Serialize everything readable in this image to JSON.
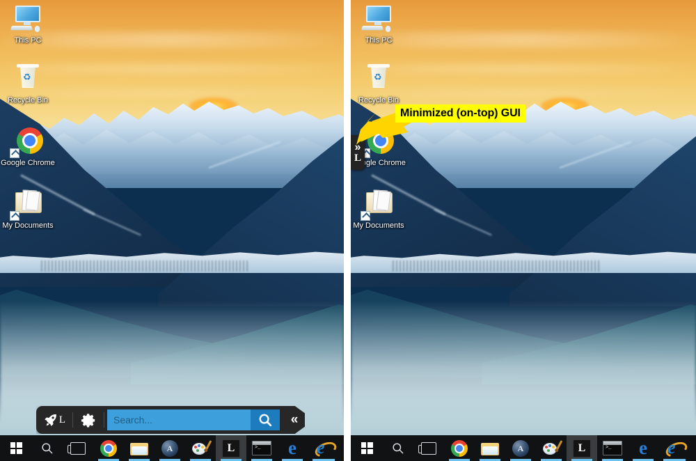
{
  "annotation": {
    "label": "Minimized (on-top) GUI",
    "label_bg": "#ffff00",
    "label_fg": "#000000",
    "arrow_color": "#ffd400"
  },
  "desktop": {
    "icons": [
      {
        "label": "This PC",
        "icon": "this-pc-icon"
      },
      {
        "label": "Recycle Bin",
        "icon": "recycle-bin-icon"
      },
      {
        "label": "Google Chrome",
        "icon": "google-chrome-icon"
      },
      {
        "label": "My Documents",
        "icon": "my-documents-icon"
      }
    ]
  },
  "gui_bar": {
    "rocket_icon": "rocket-icon",
    "rocket_letter": "L",
    "gear_icon": "gear-icon",
    "search": {
      "value": "",
      "placeholder": "Search...",
      "field_color": "#3da0dc",
      "button_color": "#1c7cbd",
      "button_icon": "magnifier-icon"
    },
    "collapse_label": "«",
    "bar_color": "#272727"
  },
  "minimized_gui": {
    "expand_label": "»",
    "app_letter": "L",
    "tab_color": "#232323"
  },
  "taskbar": {
    "background": "#101214",
    "items": [
      {
        "name": "start-button",
        "icon": "windows-logo-icon",
        "label": "Start",
        "running": false,
        "active": false
      },
      {
        "name": "search-button",
        "icon": "magnifier-icon",
        "label": "Search",
        "running": false,
        "active": false
      },
      {
        "name": "task-view-button",
        "icon": "task-view-icon",
        "label": "Task View",
        "running": false,
        "active": false
      },
      {
        "name": "chrome-button",
        "icon": "google-chrome-icon",
        "label": "Google Chrome",
        "running": true,
        "active": false
      },
      {
        "name": "file-explorer-button",
        "icon": "folder-icon",
        "label": "File Explorer",
        "running": true,
        "active": false
      },
      {
        "name": "autocad-button",
        "icon": "autocad-icon",
        "label": "AutoCAD",
        "running": true,
        "active": false
      },
      {
        "name": "paint-button",
        "icon": "paint-palette-icon",
        "label": "Paint",
        "running": true,
        "active": false
      },
      {
        "name": "l-app-button",
        "icon": "l-app-icon",
        "label": "L",
        "running": true,
        "active": true
      },
      {
        "name": "command-prompt-button",
        "icon": "command-prompt-icon",
        "label": "Command Prompt",
        "running": true,
        "active": false
      },
      {
        "name": "edge-button",
        "icon": "edge-icon",
        "label": "Microsoft Edge",
        "running": true,
        "active": false
      },
      {
        "name": "internet-explorer-button",
        "icon": "internet-explorer-icon",
        "label": "Internet Explorer",
        "running": true,
        "active": false
      }
    ]
  },
  "panels": {
    "left_name": "screenshot-panel-left",
    "right_name": "screenshot-panel-right"
  }
}
